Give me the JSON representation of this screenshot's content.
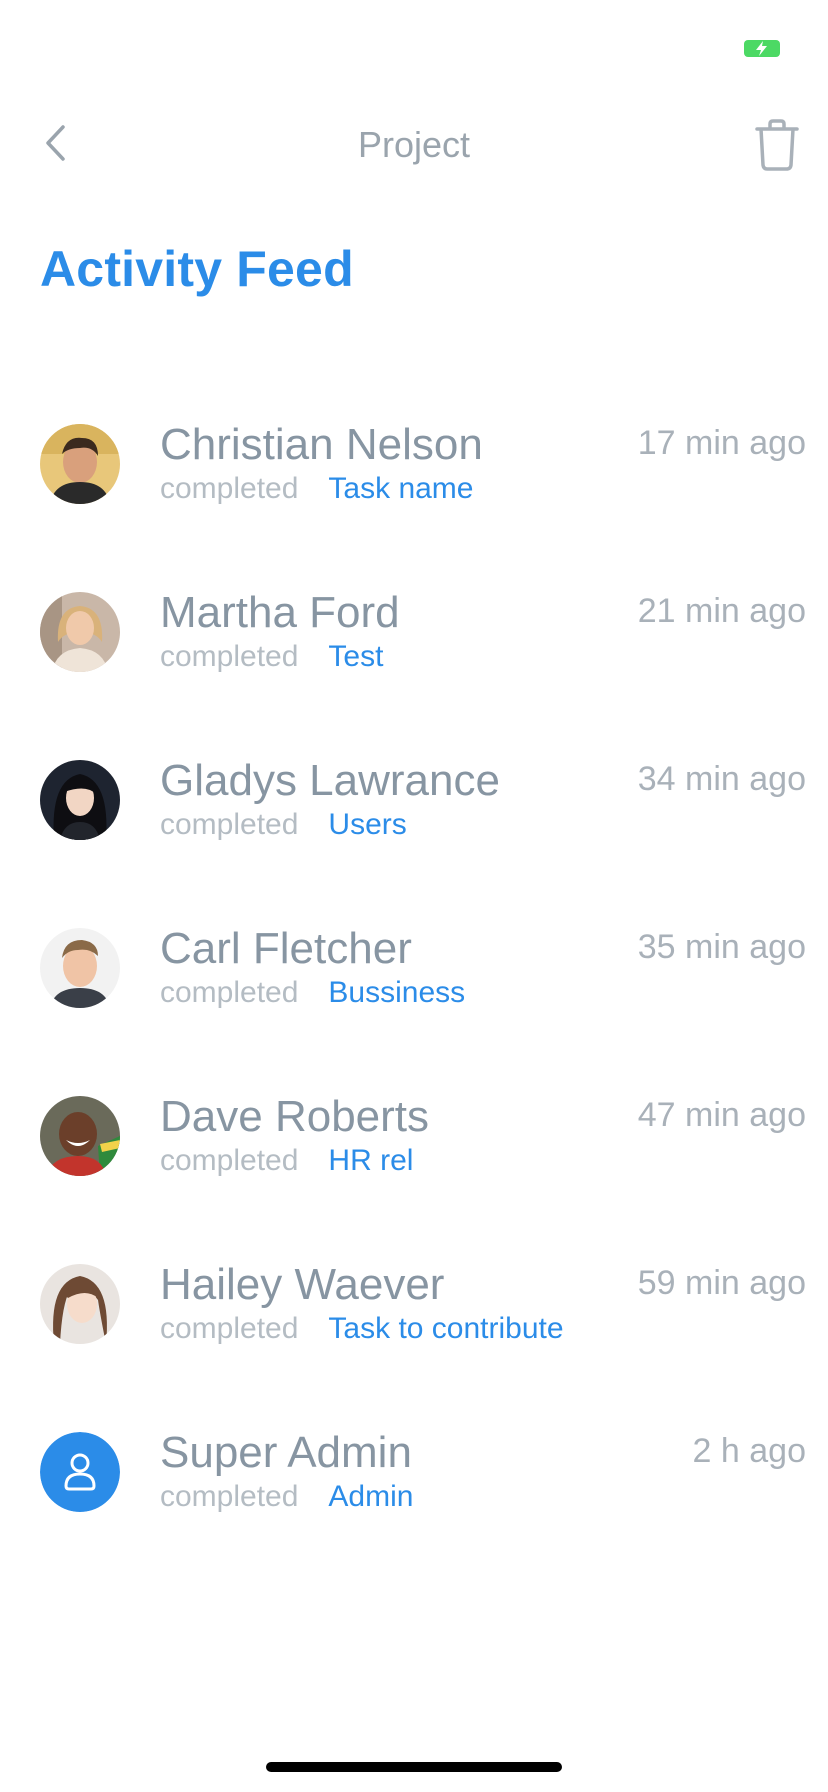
{
  "colors": {
    "accent": "#2b8ce8",
    "name_text": "#8795a2",
    "muted_text": "#b4bcc3",
    "battery": "#4cd964"
  },
  "status_bar": {
    "battery_icon": "battery-charging-icon"
  },
  "nav": {
    "back_icon": "chevron-left-icon",
    "title": "Project",
    "trash_icon": "trash-icon"
  },
  "page": {
    "title": "Activity Feed"
  },
  "feed": [
    {
      "name": "Christian Nelson",
      "verb": "completed",
      "task": "Task name",
      "time": "17 min ago",
      "avatar": "photo"
    },
    {
      "name": "Martha Ford",
      "verb": "completed",
      "task": "Test",
      "time": "21 min ago",
      "avatar": "photo"
    },
    {
      "name": "Gladys Lawrance",
      "verb": "completed",
      "task": "Users",
      "time": "34 min ago",
      "avatar": "photo"
    },
    {
      "name": "Carl Fletcher",
      "verb": "completed",
      "task": "Bussiness",
      "time": "35 min ago",
      "avatar": "photo"
    },
    {
      "name": "Dave Roberts",
      "verb": "completed",
      "task": "HR rel",
      "time": "47 min ago",
      "avatar": "photo"
    },
    {
      "name": "Hailey Waever",
      "verb": "completed",
      "task": "Task to contribute",
      "time": "59 min ago",
      "avatar": "photo"
    },
    {
      "name": "Super Admin",
      "verb": "completed",
      "task": "Admin",
      "time": "2 h ago",
      "avatar": "user-placeholder-icon"
    }
  ]
}
